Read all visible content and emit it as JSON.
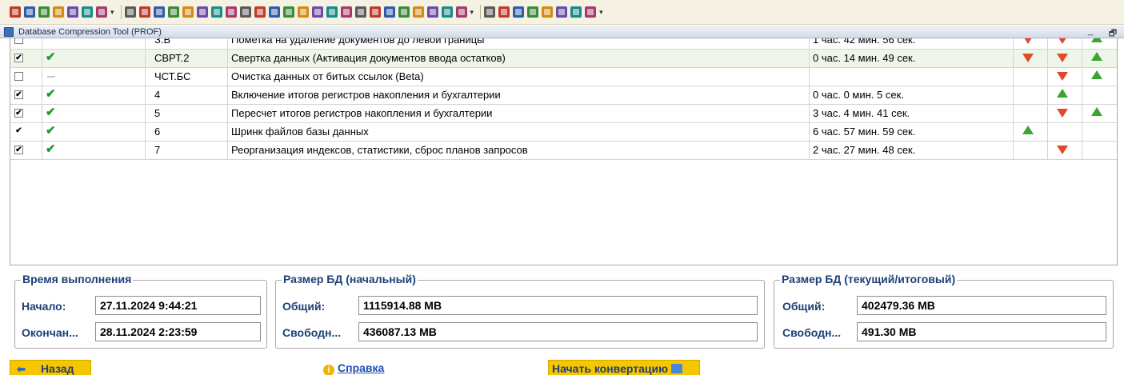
{
  "colors": {
    "toolbar_bg": "#f6f2e3",
    "label_blue": "#1d3f78",
    "button_yellow": "#f6c600",
    "ok_green": "#1f9a2a",
    "tri_red": "#e04a2a",
    "tri_green": "#3aa531",
    "row_highlight": "#eef6ea"
  },
  "toolbar": {
    "groups": [
      [
        "book-icon",
        "printer-icon",
        "printer-preview-icon",
        "printer-setup-icon",
        "binoculars-icon",
        "calculator-icon",
        "chart-icon"
      ],
      [
        "gear-red-icon",
        "gear-yellow-icon",
        "gear-blue-icon",
        "key-icon",
        "factory-icon",
        "hammer-icon",
        "brush-icon",
        "doc-blue-icon",
        "sort-red-icon",
        "doc-red-icon",
        "sort-green-icon",
        "sort-up-icon",
        "coins-icon",
        "ledger-icon",
        "sort-down-icon",
        "doc-export-icon",
        "refresh-icon",
        "doc-green-icon",
        "doc-yellow-icon",
        "doc-check-icon",
        "doc-list-icon",
        "doc-x-icon",
        "net-icon",
        "db-green-icon"
      ],
      [
        "doc-table-icon",
        "doc-table2-icon",
        "doc-table3-icon",
        "sigma-icon",
        "tool-icon",
        "db-red-icon",
        "db-blue-icon",
        "pencil-check-icon"
      ]
    ]
  },
  "window": {
    "title": "Database Compression Tool (PROF)",
    "minimize": "_",
    "restore": "🗗"
  },
  "table": {
    "rows": [
      {
        "checked": "box-empty",
        "status": "none",
        "code": "З.В",
        "name": "Пометка на удаление документов до левой границы",
        "time": "1 час. 42 мин. 56 сек.",
        "a": "down",
        "b": "down",
        "c": "up",
        "highlight": false
      },
      {
        "checked": "box-checked",
        "status": "ok",
        "code": "СВРТ.2",
        "name": "Свертка данных (Активация документов ввода остатков)",
        "time": "0 час. 14 мин. 49 сек.",
        "a": "down",
        "b": "down",
        "c": "up",
        "highlight": true
      },
      {
        "checked": "box-empty",
        "status": "dash",
        "code": "ЧСТ.БС",
        "name": "Очистка данных от битых ссылок (Beta)",
        "time": "",
        "a": "",
        "b": "down",
        "c": "up",
        "highlight": false
      },
      {
        "checked": "box-checked",
        "status": "ok",
        "code": "4",
        "name": "Включение итогов регистров накопления и бухгалтерии",
        "time": "0 час. 0 мин. 5 сек.",
        "a": "",
        "b": "up",
        "c": "",
        "highlight": false
      },
      {
        "checked": "box-checked",
        "status": "ok",
        "code": "5",
        "name": "Пересчет итогов регистров накопления и бухгалтерии",
        "time": "3 час. 4 мин. 41 сек.",
        "a": "",
        "b": "down",
        "c": "up",
        "highlight": false
      },
      {
        "checked": "plain-check",
        "status": "ok",
        "code": "6",
        "name": "Шринк файлов базы данных",
        "time": "6 час. 57 мин. 59 сек.",
        "a": "up",
        "b": "",
        "c": "",
        "highlight": false
      },
      {
        "checked": "box-checked",
        "status": "ok",
        "code": "7",
        "name": "Реорганизация индексов, статистики, сброс планов запросов",
        "time": "2 час. 27 мин. 48 сек.",
        "a": "",
        "b": "down",
        "c": "",
        "highlight": false
      }
    ]
  },
  "exec": {
    "title": "Время выполнения",
    "start_label": "Начало:",
    "start_value": "27.11.2024  9:44:21",
    "end_label": "Окончан...",
    "end_value": "28.11.2024  2:23:59"
  },
  "db_initial": {
    "title": "Размер БД (начальный)",
    "total_label": "Общий:",
    "total_value": "1115914.88 MB",
    "free_label": "Свободн...",
    "free_value": "436087.13 MB"
  },
  "db_current": {
    "title": "Размер БД (текущий/итоговый)",
    "total_label": "Общий:",
    "total_value": "402479.36 MB",
    "free_label": "Свободн...",
    "free_value": "491.30 MB"
  },
  "buttons": {
    "back": "Назад",
    "help": "Справка",
    "start": "Начать конвертацию"
  }
}
